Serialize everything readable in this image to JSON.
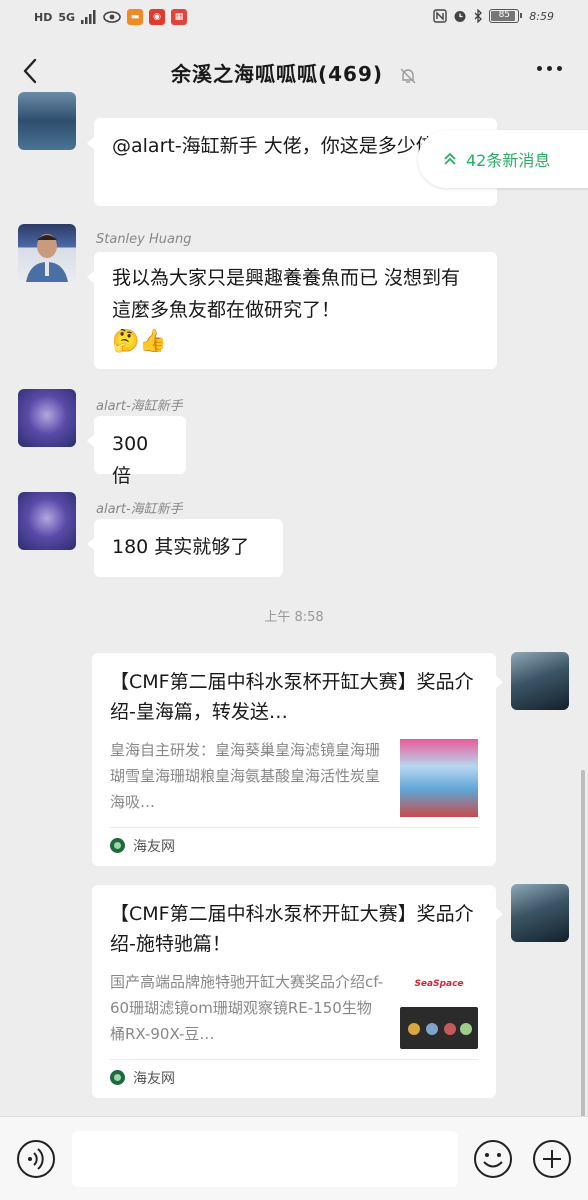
{
  "status_bar": {
    "left_icons": [
      "HD",
      "5G",
      "signal-icon",
      "eye-icon",
      "app-icon-orange",
      "app-icon-red",
      "app-icon-badge"
    ],
    "hd": "HD",
    "network": "5G",
    "battery": "85",
    "time": "8:59"
  },
  "header": {
    "title": "余溪之海呱呱呱(469)"
  },
  "new_messages": {
    "label": "42条新消息"
  },
  "messages": [
    {
      "sender": "",
      "text": "@alart-海缸新手  大佬，你这是多少倍的？"
    },
    {
      "sender": "Stanley Huang",
      "text": "我以為大家只是興趣養養魚而已 沒想到有這麼多魚友都在做研究了！",
      "emoji": "🤔👍"
    },
    {
      "sender": "alart-海缸新手",
      "text": "300 倍"
    },
    {
      "sender": "alart-海缸新手",
      "text": "180 其实就够了"
    }
  ],
  "timestamp": "上午 8:58",
  "cards": [
    {
      "title": "【CMF第二届中科水泵杯开缸大赛】奖品介绍-皇海篇，转发送…",
      "desc": "皇海自主研发：皇海葵巢皇海滤镜皇海珊瑚雪皇海珊瑚粮皇海氨基酸皇海活性炭皇海吸…",
      "source": "海友网"
    },
    {
      "title": "【CMF第二届中科水泵杯开缸大赛】奖品介绍-施特驰篇！",
      "desc": "国产高端品牌施特驰开缸大赛奖品介绍cf-60珊瑚滤镜om珊瑚观察镜RE-150生物桶RX-90X-豆…",
      "source": "海友网",
      "thumb_brand": "SeaSpace"
    }
  ],
  "input": {
    "placeholder": ""
  },
  "colors": {
    "accent_green": "#2aae67",
    "background": "#ededed",
    "bubble": "#ffffff"
  }
}
